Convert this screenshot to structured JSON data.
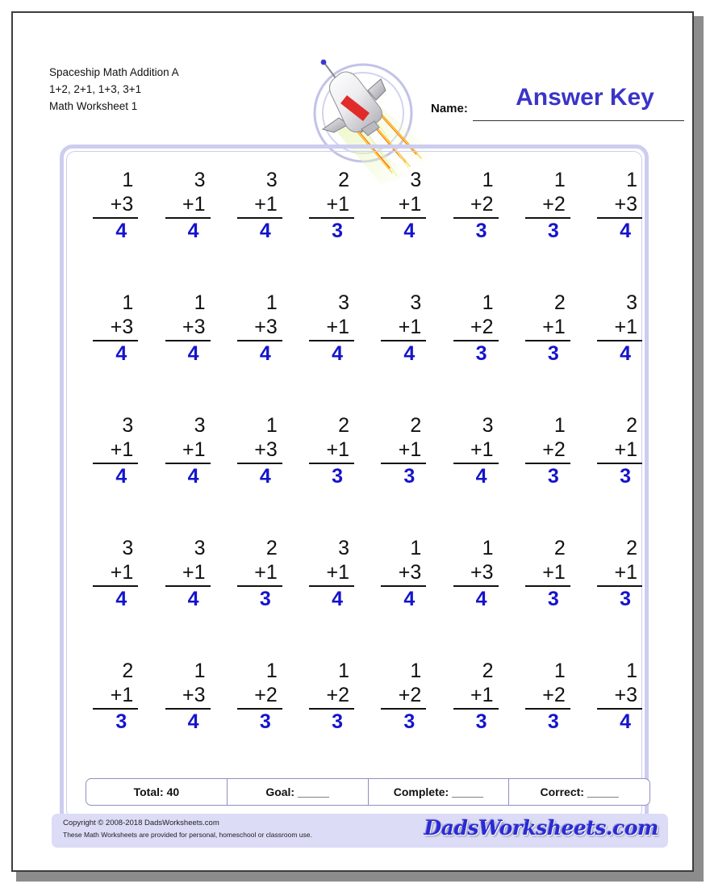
{
  "header": {
    "title": "Spaceship Math Addition A",
    "facts": "1+2, 2+1, 1+3, 3+1",
    "worksheet": "Math Worksheet 1"
  },
  "name_field": {
    "label": "Name:",
    "value": "Answer Key",
    "placeholder": ""
  },
  "emblem": {
    "icon": "rocket-icon",
    "ring_color": "#c2c2e8",
    "body_color": "#e8e8ea",
    "stripe_color": "#e02b2b",
    "exhaust_color": "#ff8c00",
    "glow_color": "#ddf0a8"
  },
  "colors": {
    "answer_blue": "#1414cc",
    "title_blue": "#3a34c8",
    "panel_purple": "#cdcdf0",
    "footer_purple": "#dcdcf7",
    "page_border": "#3d3d3d"
  },
  "grid": {
    "columns": 8,
    "rows": 5,
    "problems": [
      {
        "top": "1",
        "bottom": "+3",
        "answer": "4"
      },
      {
        "top": "3",
        "bottom": "+1",
        "answer": "4"
      },
      {
        "top": "3",
        "bottom": "+1",
        "answer": "4"
      },
      {
        "top": "2",
        "bottom": "+1",
        "answer": "3"
      },
      {
        "top": "3",
        "bottom": "+1",
        "answer": "4"
      },
      {
        "top": "1",
        "bottom": "+2",
        "answer": "3"
      },
      {
        "top": "1",
        "bottom": "+2",
        "answer": "3"
      },
      {
        "top": "1",
        "bottom": "+3",
        "answer": "4"
      },
      {
        "top": "1",
        "bottom": "+3",
        "answer": "4"
      },
      {
        "top": "1",
        "bottom": "+3",
        "answer": "4"
      },
      {
        "top": "1",
        "bottom": "+3",
        "answer": "4"
      },
      {
        "top": "3",
        "bottom": "+1",
        "answer": "4"
      },
      {
        "top": "3",
        "bottom": "+1",
        "answer": "4"
      },
      {
        "top": "1",
        "bottom": "+2",
        "answer": "3"
      },
      {
        "top": "2",
        "bottom": "+1",
        "answer": "3"
      },
      {
        "top": "3",
        "bottom": "+1",
        "answer": "4"
      },
      {
        "top": "3",
        "bottom": "+1",
        "answer": "4"
      },
      {
        "top": "3",
        "bottom": "+1",
        "answer": "4"
      },
      {
        "top": "1",
        "bottom": "+3",
        "answer": "4"
      },
      {
        "top": "2",
        "bottom": "+1",
        "answer": "3"
      },
      {
        "top": "2",
        "bottom": "+1",
        "answer": "3"
      },
      {
        "top": "3",
        "bottom": "+1",
        "answer": "4"
      },
      {
        "top": "1",
        "bottom": "+2",
        "answer": "3"
      },
      {
        "top": "2",
        "bottom": "+1",
        "answer": "3"
      },
      {
        "top": "3",
        "bottom": "+1",
        "answer": "4"
      },
      {
        "top": "3",
        "bottom": "+1",
        "answer": "4"
      },
      {
        "top": "2",
        "bottom": "+1",
        "answer": "3"
      },
      {
        "top": "3",
        "bottom": "+1",
        "answer": "4"
      },
      {
        "top": "1",
        "bottom": "+3",
        "answer": "4"
      },
      {
        "top": "1",
        "bottom": "+3",
        "answer": "4"
      },
      {
        "top": "2",
        "bottom": "+1",
        "answer": "3"
      },
      {
        "top": "2",
        "bottom": "+1",
        "answer": "3"
      },
      {
        "top": "2",
        "bottom": "+1",
        "answer": "3"
      },
      {
        "top": "1",
        "bottom": "+3",
        "answer": "4"
      },
      {
        "top": "1",
        "bottom": "+2",
        "answer": "3"
      },
      {
        "top": "1",
        "bottom": "+2",
        "answer": "3"
      },
      {
        "top": "1",
        "bottom": "+2",
        "answer": "3"
      },
      {
        "top": "2",
        "bottom": "+1",
        "answer": "3"
      },
      {
        "top": "1",
        "bottom": "+2",
        "answer": "3"
      },
      {
        "top": "1",
        "bottom": "+3",
        "answer": "4"
      }
    ]
  },
  "score_row": {
    "cells": [
      {
        "label": "Total: 40"
      },
      {
        "label": "Goal: _____"
      },
      {
        "label": "Complete: _____"
      },
      {
        "label": "Correct: _____"
      }
    ]
  },
  "footer": {
    "copyright_line1": "Copyright © 2008-2018 DadsWorksheets.com",
    "copyright_line2": "These Math Worksheets are provided for personal, homeschool or classroom use.",
    "brand": "DadsWorksheets.com"
  }
}
